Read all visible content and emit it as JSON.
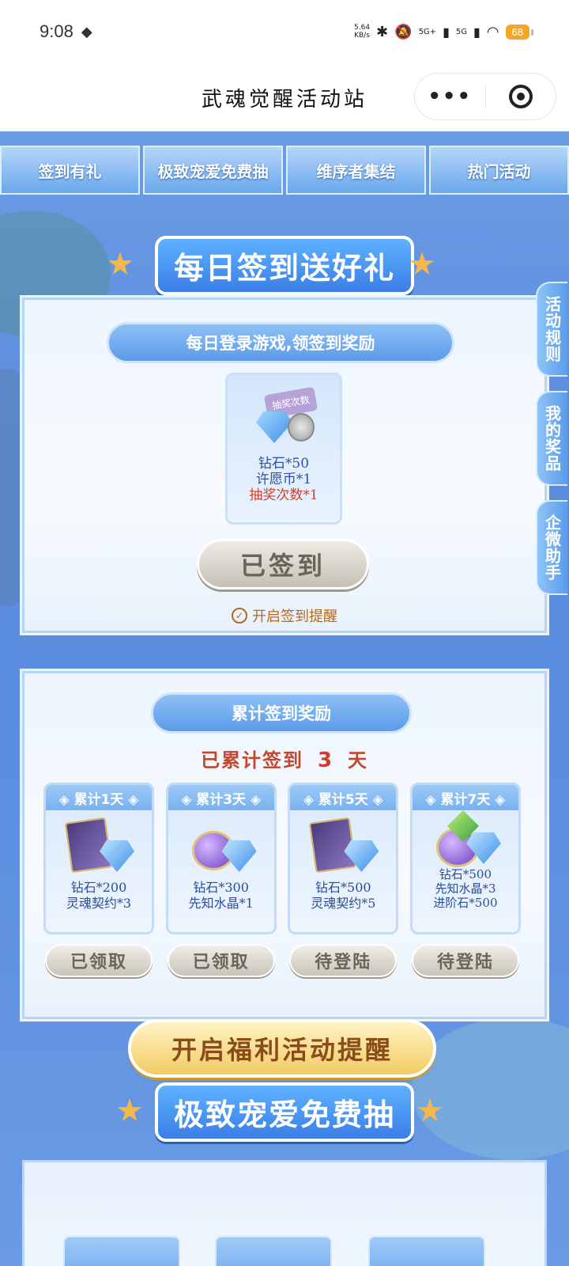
{
  "status": {
    "time": "9:08",
    "net_speed_value": "5.64",
    "net_speed_unit": "KB/s",
    "network_1": "5G+",
    "network_2": "5G",
    "battery": "68"
  },
  "titlebar": {
    "title": "武魂觉醒活动站",
    "more_label": "•••"
  },
  "tabs": [
    "签到有礼",
    "极致宠爱免费抽",
    "维序者集结",
    "热门活动"
  ],
  "daily": {
    "banner": "每日签到送好礼",
    "subtitle": "每日登录游戏,领签到奖励",
    "ticket_label": "抽奖次数",
    "reward_line1": "钻石*50",
    "reward_line2": "许愿币*1",
    "reward_line3": "抽奖次数*1",
    "button": "已签到",
    "remind": "开启签到提醒"
  },
  "side_tabs": [
    "活动规则",
    "我的奖品",
    "企微助手"
  ],
  "cumulative": {
    "subtitle": "累计签到奖励",
    "prefix": "已累计签到",
    "days": "3",
    "suffix": "天",
    "milestones": [
      {
        "head": "◈ 累计1天 ◈",
        "line1": "钻石*200",
        "line2": "灵魂契约*3",
        "line3": "",
        "button": "已领取"
      },
      {
        "head": "◈ 累计3天 ◈",
        "line1": "钻石*300",
        "line2": "先知水晶*1",
        "line3": "",
        "button": "已领取"
      },
      {
        "head": "◈ 累计5天 ◈",
        "line1": "钻石*500",
        "line2": "灵魂契约*5",
        "line3": "",
        "button": "待登陆"
      },
      {
        "head": "◈ 累计7天 ◈",
        "line1": "钻石*500",
        "line2": "先知水晶*3",
        "line3": "进阶石*500",
        "button": "待登陆"
      }
    ]
  },
  "free_draw": {
    "banner": "极致宠爱免费抽",
    "welfare_button": "开启福利活动提醒"
  }
}
